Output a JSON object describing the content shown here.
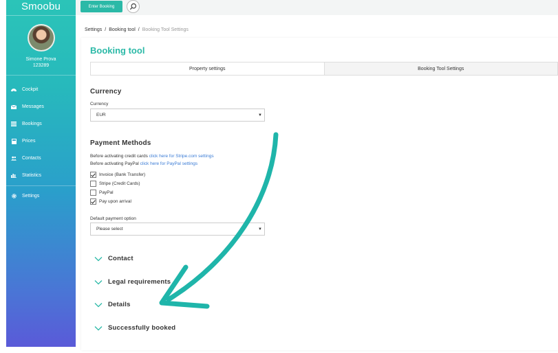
{
  "sidebar": {
    "logo": "Smoobu",
    "user_name": "Simone Prova",
    "user_id": "123289",
    "items": [
      {
        "label": "Cockpit",
        "icon": "dashboard-icon"
      },
      {
        "label": "Messages",
        "icon": "envelope-icon"
      },
      {
        "label": "Bookings",
        "icon": "list-icon"
      },
      {
        "label": "Prices",
        "icon": "calculator-icon"
      },
      {
        "label": "Contacts",
        "icon": "users-icon"
      },
      {
        "label": "Statistics",
        "icon": "bar-chart-icon"
      },
      {
        "label": "Settings",
        "icon": "gear-icon"
      }
    ]
  },
  "topbar": {
    "enter_booking_label": "Enter Booking"
  },
  "breadcrumb": {
    "items": [
      "Settings",
      "Booking tool",
      "Booking Tool Settings"
    ]
  },
  "page": {
    "title": "Booking tool",
    "tabs": [
      "Property settings",
      "Booking Tool Settings"
    ]
  },
  "currency": {
    "section_title": "Currency",
    "field_label": "Currency",
    "selected": "EUR"
  },
  "payment": {
    "section_title": "Payment Methods",
    "credit_text": "Before activating credit cards",
    "credit_link": "click here for Stripe.com settings",
    "paypal_text": "Before activating PayPal",
    "paypal_link": "click here for PayPal settings",
    "methods": [
      {
        "label": "Invoice (Bank Transfer)",
        "checked": true
      },
      {
        "label": "Stripe (Credit Cards)",
        "checked": false
      },
      {
        "label": "PayPal",
        "checked": false
      },
      {
        "label": "Pay upon arrival",
        "checked": true
      }
    ],
    "default_label": "Default payment option",
    "default_selected": "Please select"
  },
  "accordions": [
    "Contact",
    "Legal requirements",
    "Details",
    "Successfully booked"
  ],
  "colors": {
    "brand": "#2bb9a7",
    "link": "#3a7bd5",
    "annotation": "#1fb5aa"
  }
}
